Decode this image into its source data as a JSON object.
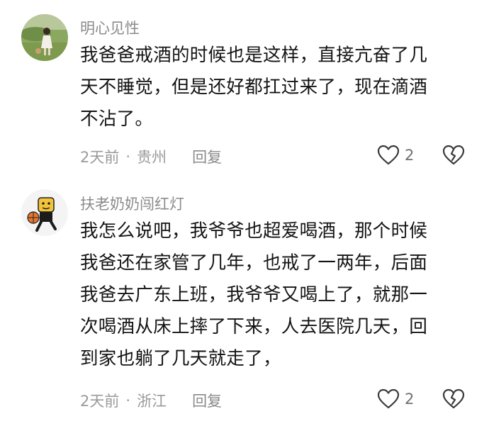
{
  "comments": [
    {
      "username": "明心见性",
      "lines": [
        "我爸爸戒酒的时候也是这样，直接亢奋了几",
        "天不睡觉，但是还好都扛过来了，现在滴酒",
        "不沾了。"
      ],
      "time": "2天前",
      "location": "贵州",
      "reply_label": "回复",
      "likes": "2"
    },
    {
      "username": "扶老奶奶闯红灯",
      "lines": [
        "我怎么说吧，我爷爷也超爱喝酒，那个时候",
        "我爸还在家管了几年，也戒了一两年，后面",
        "我爸去广东上班，我爷爷又喝上了，就那一",
        "次喝酒从床上摔了下来，人去医院几天，回",
        "到家也躺了几天就走了，"
      ],
      "time": "2天前",
      "location": "浙江",
      "reply_label": "回复",
      "likes": "2"
    }
  ],
  "separator": "·",
  "icons": {
    "like": "heart-outline-icon",
    "dislike": "broken-heart-icon",
    "avatar1": "avatar-photo-girl-on-grass",
    "avatar2": "avatar-cartoon-basketball-player"
  }
}
